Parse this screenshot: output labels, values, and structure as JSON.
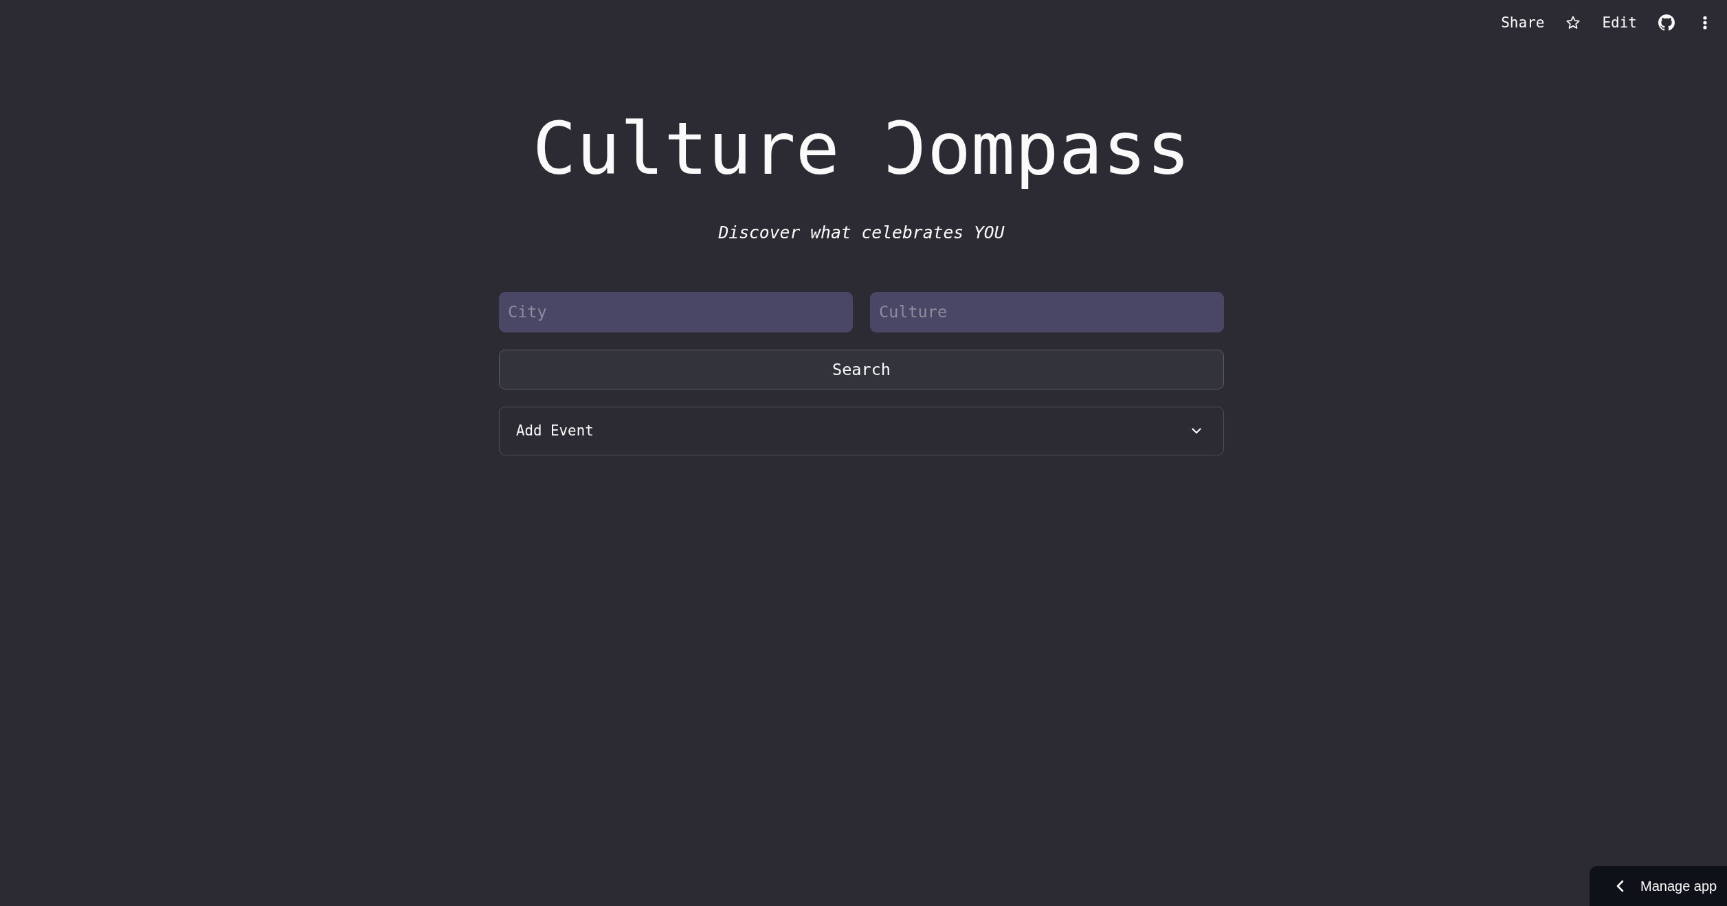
{
  "toolbar": {
    "share_label": "Share",
    "edit_label": "Edit"
  },
  "header": {
    "title": "Culture Ɔompass",
    "subtitle": "Discover what celebrates YOU"
  },
  "search_form": {
    "fields": [
      {
        "placeholder": "City"
      },
      {
        "placeholder": "Culture"
      }
    ],
    "button_label": "Search"
  },
  "expander": {
    "label": "Add Event",
    "expanded": false
  },
  "manage_app": {
    "label": "Manage app"
  }
}
